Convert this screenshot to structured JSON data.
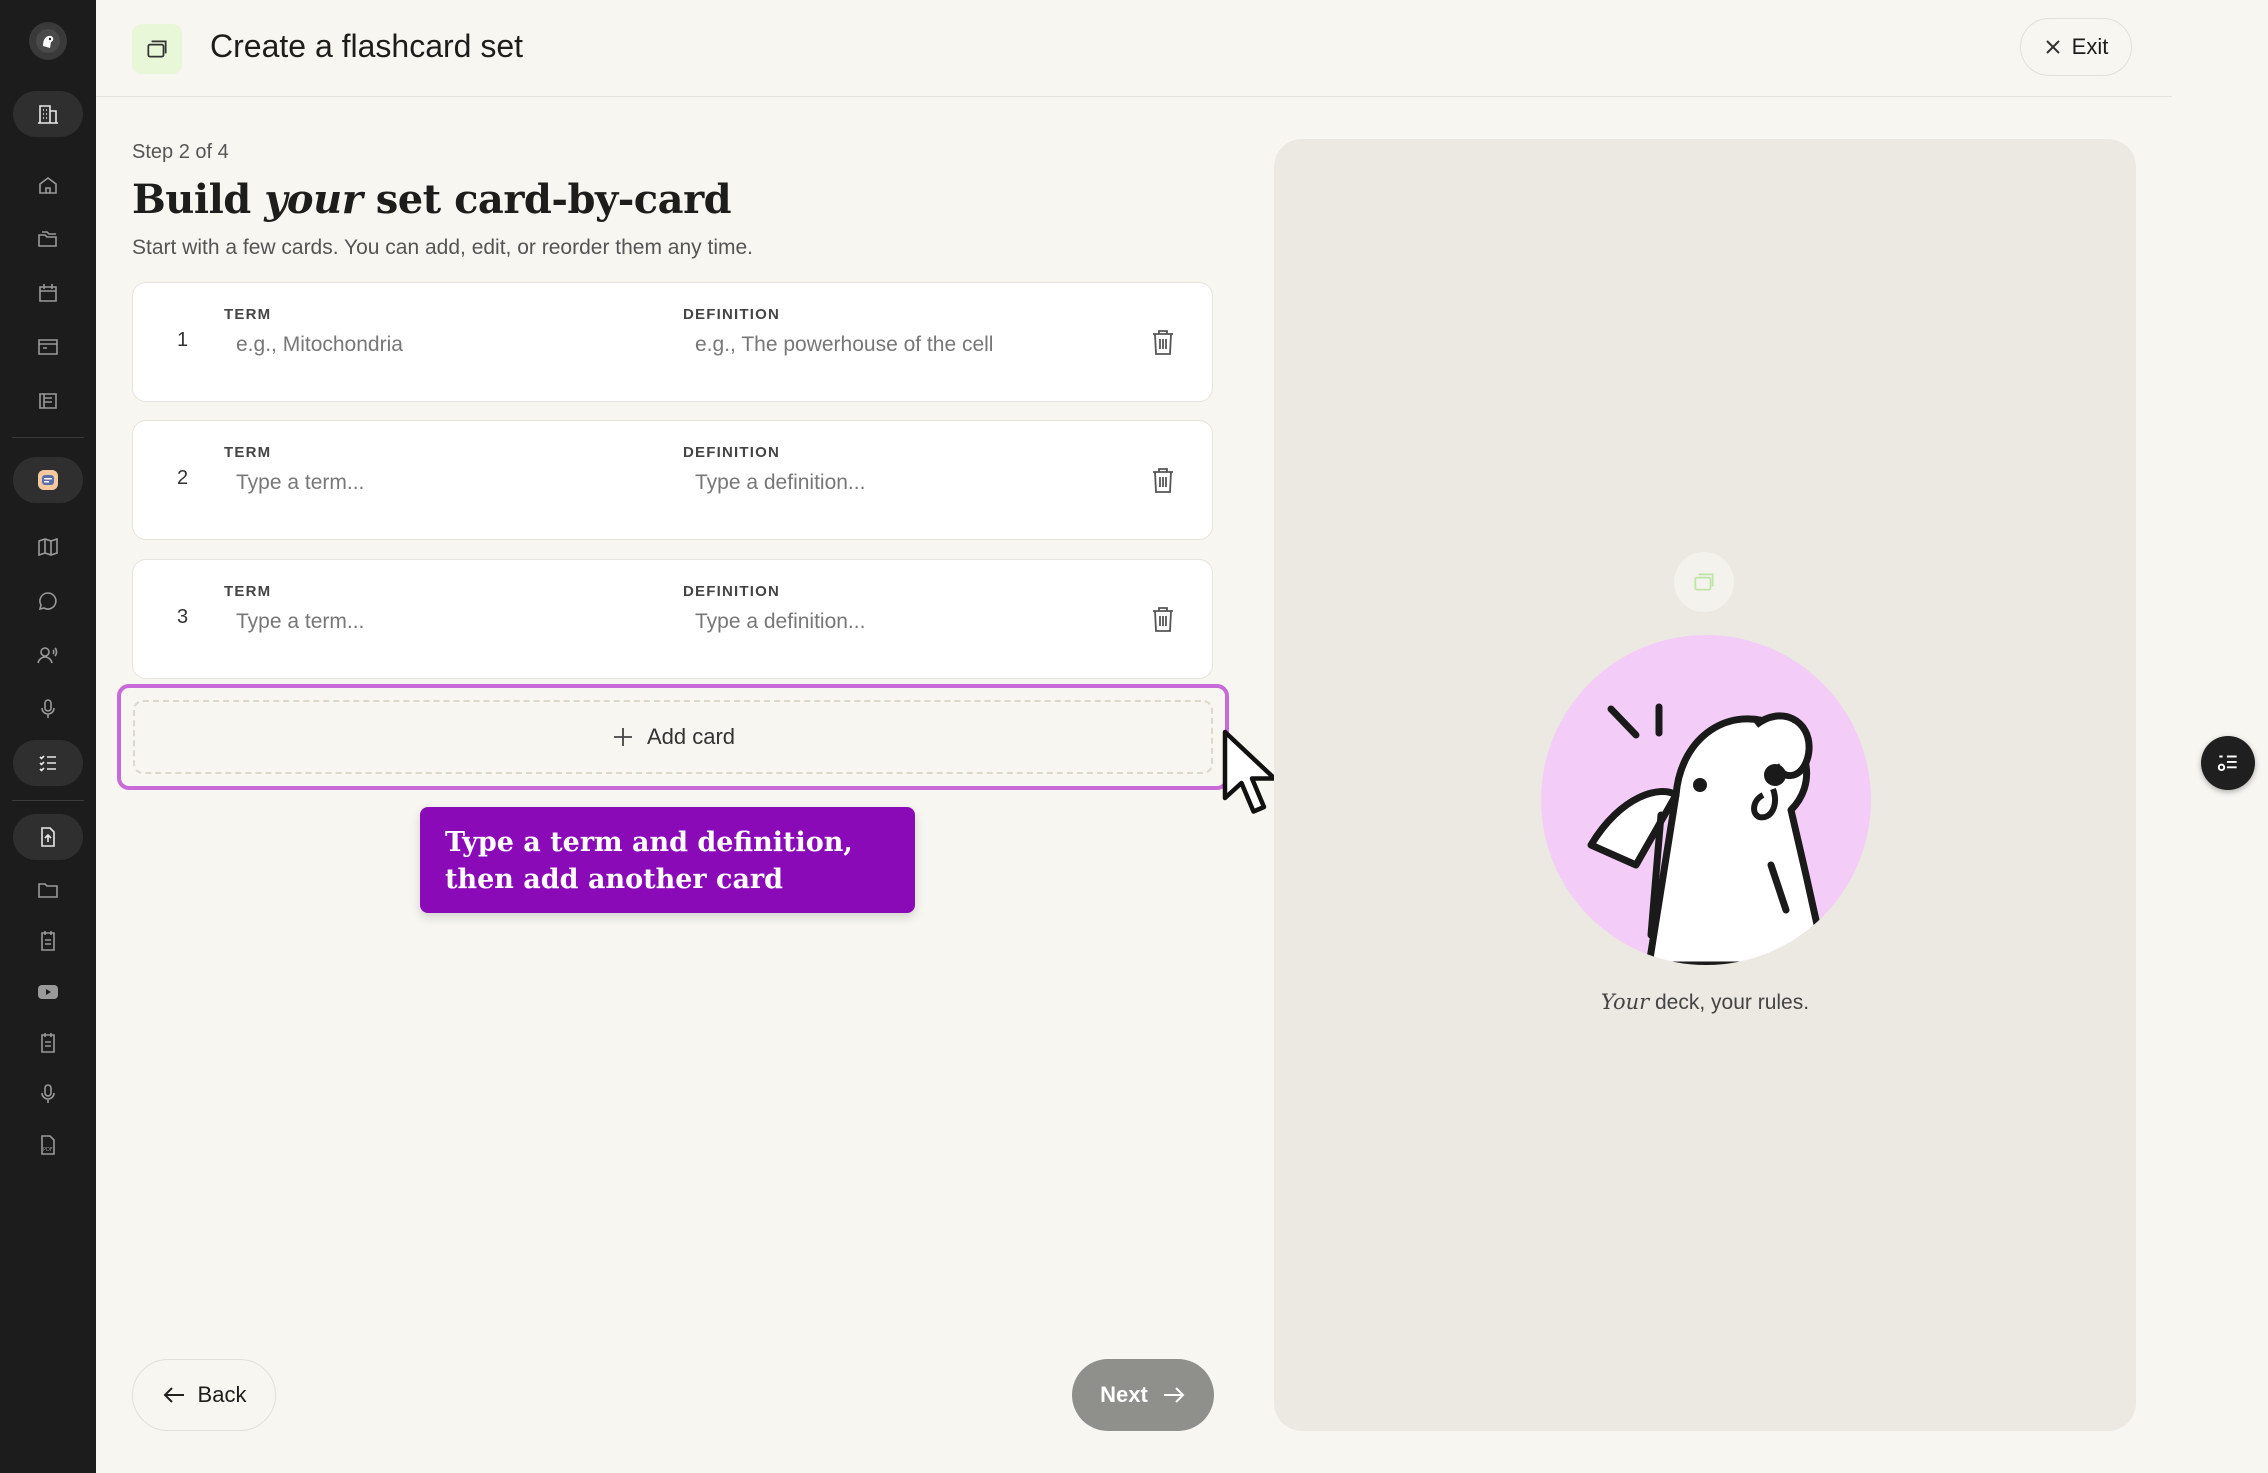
{
  "header": {
    "title": "Create a flashcard set",
    "exit_label": "Exit"
  },
  "main": {
    "step": "Step 2 of 4",
    "heading_pre": "Build ",
    "heading_em": "your",
    "heading_post": " set card-by-card",
    "subtitle": "Start with a few cards. You can add, edit, or reorder them any time.",
    "term_label": "TERM",
    "definition_label": "DEFINITION",
    "cards": [
      {
        "number": "1",
        "term_placeholder": "e.g., Mitochondria",
        "definition_placeholder": "e.g., The powerhouse of the cell"
      },
      {
        "number": "2",
        "term_placeholder": "Type a term...",
        "definition_placeholder": "Type a definition..."
      },
      {
        "number": "3",
        "term_placeholder": "Type a term...",
        "definition_placeholder": "Type a definition..."
      }
    ],
    "add_card_label": "Add card",
    "tooltip": "Type a term and definition, then add another card",
    "back_label": "Back",
    "next_label": "Next"
  },
  "preview": {
    "caption_em": "Your",
    "caption_rest": " deck, your rules."
  },
  "colors": {
    "accent_purple": "#8b0ab8",
    "highlight_border": "#c86ad8",
    "preview_circle": "#f3cdf7",
    "icon_bg_green": "#e7f7d8",
    "sidebar_bg": "#1c1c1c",
    "next_disabled": "#8f8f8c"
  },
  "sidebar": {
    "icons": [
      "logo-icon",
      "building-icon",
      "home-icon",
      "folders-icon",
      "calendar-icon",
      "window-icon",
      "library-icon",
      "app-avatar-icon",
      "map-icon",
      "chat-icon",
      "voice-user-icon",
      "mic-icon",
      "checklist-icon",
      "file-upload-icon",
      "folder-icon",
      "notes-icon",
      "video-icon",
      "notes2-icon",
      "mic2-icon",
      "pdf-icon"
    ]
  }
}
